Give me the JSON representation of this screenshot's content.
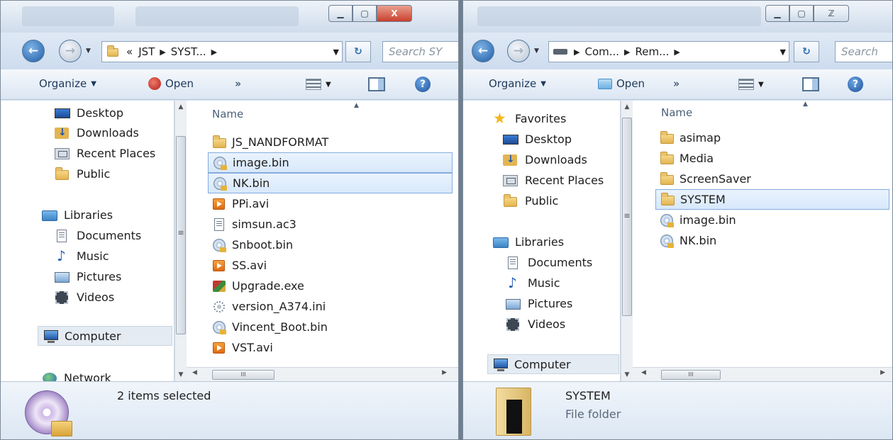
{
  "left": {
    "address": {
      "prefix": "«",
      "crumbs": [
        "JST",
        "SYST..."
      ]
    },
    "search_placeholder": "Search SY",
    "toolbar": {
      "organize": "Organize",
      "open": "Open",
      "more": "»"
    },
    "nav": {
      "favorites": [
        {
          "label": "Desktop",
          "icon": "desktop-icon"
        },
        {
          "label": "Downloads",
          "icon": "downloads-icon"
        },
        {
          "label": "Recent Places",
          "icon": "recent-places-icon"
        },
        {
          "label": "Public",
          "icon": "folder-icon"
        }
      ],
      "libraries_label": "Libraries",
      "libraries": [
        {
          "label": "Documents",
          "icon": "documents-icon"
        },
        {
          "label": "Music",
          "icon": "music-icon"
        },
        {
          "label": "Pictures",
          "icon": "pictures-icon"
        },
        {
          "label": "Videos",
          "icon": "videos-icon"
        }
      ],
      "computer_label": "Computer",
      "network_label": "Network"
    },
    "column_name": "Name",
    "files": [
      {
        "name": "JS_NANDFORMAT",
        "icon": "folder-icon",
        "selected": false
      },
      {
        "name": "image.bin",
        "icon": "disc-image-icon",
        "selected": true
      },
      {
        "name": "NK.bin",
        "icon": "disc-image-icon",
        "selected": true
      },
      {
        "name": "PPi.avi",
        "icon": "video-file-icon",
        "selected": false
      },
      {
        "name": "simsun.ac3",
        "icon": "document-icon",
        "selected": false
      },
      {
        "name": "Snboot.bin",
        "icon": "disc-image-icon",
        "selected": false
      },
      {
        "name": "SS.avi",
        "icon": "video-file-icon",
        "selected": false
      },
      {
        "name": "Upgrade.exe",
        "icon": "installer-icon",
        "selected": false
      },
      {
        "name": "version_A374.ini",
        "icon": "settings-file-icon",
        "selected": false
      },
      {
        "name": "Vincent_Boot.bin",
        "icon": "disc-image-icon",
        "selected": false
      },
      {
        "name": "VST.avi",
        "icon": "video-file-icon",
        "selected": false
      }
    ],
    "hscroll_label": "III",
    "details": {
      "status": "2 items selected"
    }
  },
  "right": {
    "address": {
      "crumbs": [
        "Com...",
        "Rem..."
      ]
    },
    "search_placeholder": "Search",
    "toolbar": {
      "organize": "Organize",
      "open": "Open",
      "more": "»"
    },
    "nav": {
      "favorites_label": "Favorites",
      "favorites": [
        {
          "label": "Desktop",
          "icon": "desktop-icon"
        },
        {
          "label": "Downloads",
          "icon": "downloads-icon"
        },
        {
          "label": "Recent Places",
          "icon": "recent-places-icon"
        },
        {
          "label": "Public",
          "icon": "folder-icon"
        }
      ],
      "libraries_label": "Libraries",
      "libraries": [
        {
          "label": "Documents",
          "icon": "documents-icon"
        },
        {
          "label": "Music",
          "icon": "music-icon"
        },
        {
          "label": "Pictures",
          "icon": "pictures-icon"
        },
        {
          "label": "Videos",
          "icon": "videos-icon"
        }
      ],
      "computer_label": "Computer"
    },
    "column_name": "Name",
    "files": [
      {
        "name": "asimap",
        "icon": "folder-icon",
        "selected": false
      },
      {
        "name": "Media",
        "icon": "folder-icon",
        "selected": false
      },
      {
        "name": "ScreenSaver",
        "icon": "folder-icon",
        "selected": false
      },
      {
        "name": "SYSTEM",
        "icon": "folder-icon",
        "selected": true
      },
      {
        "name": "image.bin",
        "icon": "disc-image-icon",
        "selected": false
      },
      {
        "name": "NK.bin",
        "icon": "disc-image-icon",
        "selected": false
      }
    ],
    "hscroll_label": "III",
    "details": {
      "name": "SYSTEM",
      "type": "File folder"
    }
  },
  "window_controls": {
    "minimize": "▁",
    "maximize": "▢",
    "close": "X",
    "close_inactive": "ℤ"
  }
}
